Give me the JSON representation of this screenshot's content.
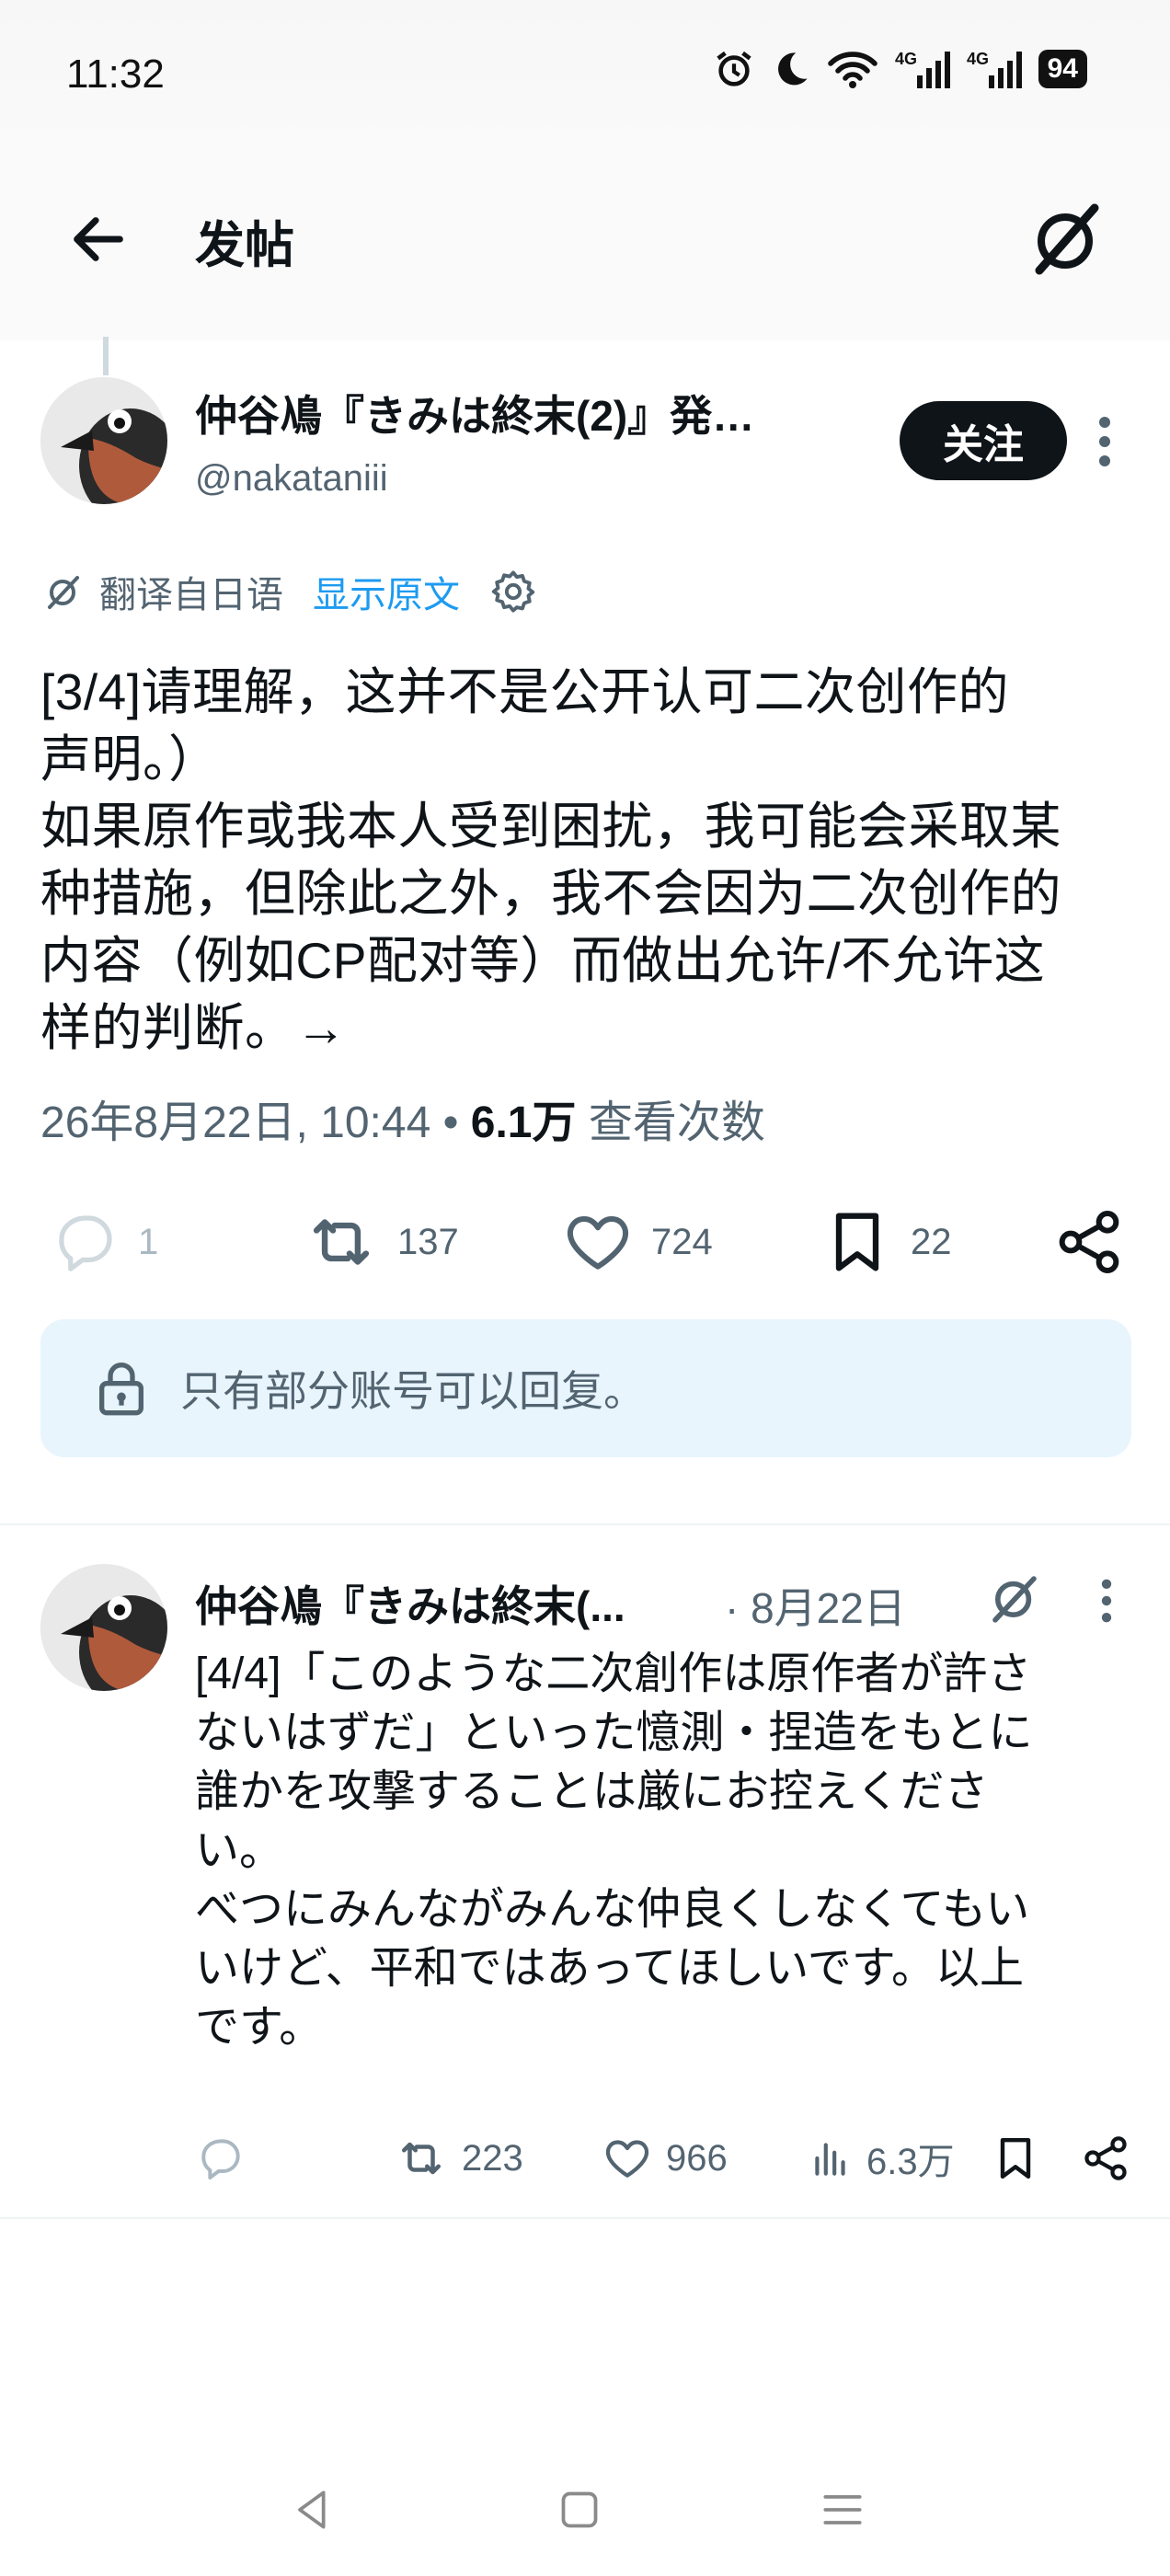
{
  "status_bar": {
    "time": "11:32",
    "battery": "94",
    "network_1": "4G",
    "network_2": "4G"
  },
  "header": {
    "title": "发帖"
  },
  "post": {
    "author_name": "仲谷鳰『きみは終末(2)』発…",
    "handle": "@nakataniii",
    "follow_label": "关注",
    "translate_label": "翻译自日语",
    "show_original_label": "显示原文",
    "body": "[3/4]请理解，这并不是公开认可二次创作的\n声明。）\n如果原作或我本人受到困扰，我可能会采取某\n种措施，但除此之外，我不会因为二次创作的\n内容（例如CP配对等）而做出允许/不允许这\n样的判断。→",
    "timestamp": "26年8月22日, 10:44",
    "separator": " • ",
    "views_count": "6.1万",
    "views_label": " 查看次数",
    "replies": "1",
    "reposts": "137",
    "likes": "724",
    "bookmarks": "22",
    "reply_restriction": "只有部分账号可以回复。"
  },
  "reply": {
    "author_name": "仲谷鳰『きみは終末(...",
    "date": "· 8月22日",
    "body": "[4/4]「このような二次創作は原作者が許さ\nないはずだ」といった憶測・捏造をもとに\n誰かを攻撃することは厳にお控えくださ\nい。\nべつにみんながみんな仲良くしなくてもい\nいけど、平和ではあってほしいです。以上\nです。",
    "reposts": "223",
    "likes": "966",
    "views": "6.3万"
  },
  "colors": {
    "text_primary": "#0f1419",
    "text_secondary": "#536471",
    "accent": "#1d9bf0",
    "banner_bg": "#e8f5fd"
  }
}
